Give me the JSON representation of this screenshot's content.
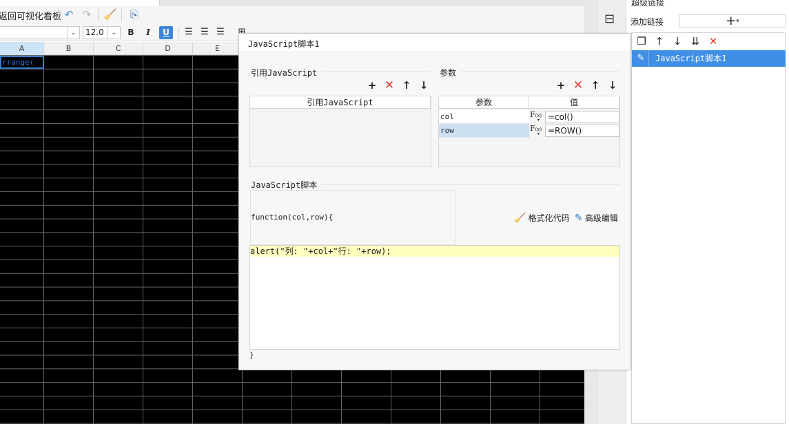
{
  "app": {
    "back_to_dashboard": "返回可视化看板"
  },
  "toolbar": {
    "font_name": "",
    "font_size": "12.0",
    "bold": "B",
    "italic": "I",
    "underline": "U"
  },
  "spreadsheet": {
    "columns": [
      "A",
      "B",
      "C",
      "D",
      "E"
    ],
    "selected_column": "A",
    "cell_a1_text": "rrange("
  },
  "right_panel": {
    "title": "超级链接",
    "add_link_label": "添加链接",
    "add_link_button": "+",
    "items": [
      {
        "label": "JavaScript脚本1",
        "selected": true
      }
    ]
  },
  "dialog": {
    "title": "JavaScript脚本1",
    "ref_js": {
      "group_label": "引用JavaScript",
      "column_header": "引用JavaScript",
      "rows": []
    },
    "params": {
      "group_label": "参数",
      "headers": [
        "参数",
        "值"
      ],
      "rows": [
        {
          "name": "col",
          "value": "=col()",
          "selected": false
        },
        {
          "name": "row",
          "value": "=ROW()",
          "selected": true
        }
      ]
    },
    "script": {
      "group_label": "JavaScript脚本",
      "function_signature": "function(col,row){",
      "format_code_label": "格式化代码",
      "advanced_edit_label": "高级编辑",
      "code_line_1": "alert(\"列: \"+col+\"行: \"+row);",
      "closing_brace": "}"
    }
  }
}
